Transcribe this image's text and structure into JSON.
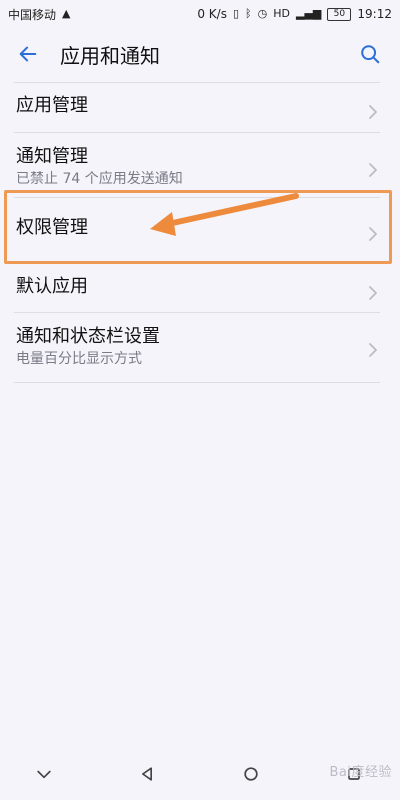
{
  "status_bar": {
    "carrier": "中国移动",
    "network_speed": "0 K/s",
    "hd_badge": "HD",
    "battery": "50",
    "time": "19:12",
    "icons": [
      "bluetooth-icon",
      "vibrate-icon",
      "alarm-icon",
      "signal-icon",
      "battery-icon"
    ]
  },
  "header": {
    "title": "应用和通知",
    "back_icon": "back-arrow-icon",
    "search_icon": "search-icon"
  },
  "settings": {
    "items": [
      {
        "title": "应用管理"
      },
      {
        "title": "通知管理",
        "subtitle": "已禁止 74 个应用发送通知"
      },
      {
        "title": "权限管理"
      },
      {
        "title": "默认应用"
      },
      {
        "title": "通知和状态栏设置",
        "subtitle": "电量百分比显示方式"
      }
    ]
  },
  "watermark": "Bai度经验",
  "colors": {
    "accent": "#2c6fd6",
    "highlight": "#ee9a55",
    "background": "#f5f4fa"
  }
}
